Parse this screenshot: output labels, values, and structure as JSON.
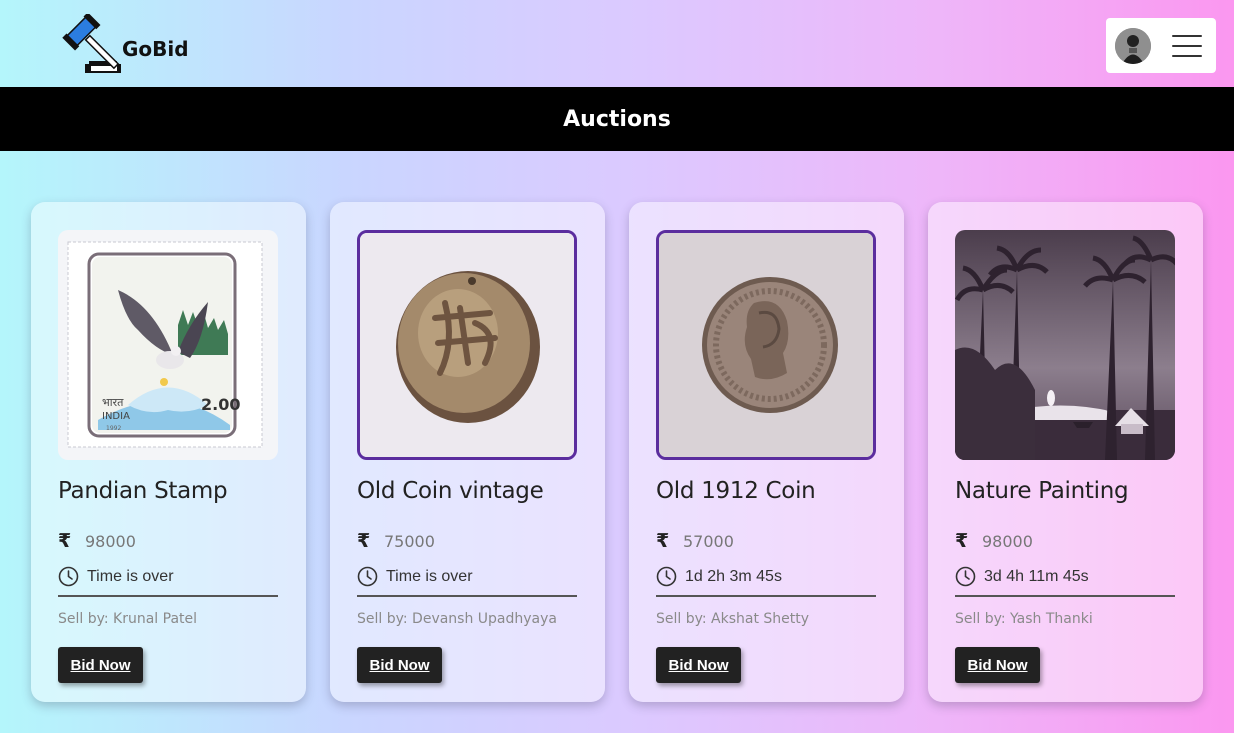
{
  "app": {
    "name": "GoBid"
  },
  "header": {
    "menu_icon": "hamburger-icon",
    "avatar_icon": "user-avatar"
  },
  "banner": {
    "title": "Auctions"
  },
  "currency_symbol": "₹",
  "cards": [
    {
      "title": "Pandian Stamp",
      "price": "98000",
      "time": "Time is over",
      "seller": "Sell by: Krunal Patel",
      "button": "Bid Now",
      "image": "stamp-image"
    },
    {
      "title": "Old Coin vintage",
      "price": "75000",
      "time": "Time is over",
      "seller": "Sell by: Devansh Upadhyaya",
      "button": "Bid Now",
      "image": "coin-image"
    },
    {
      "title": "Old 1912 Coin",
      "price": "57000",
      "time": "1d 2h 3m 45s",
      "seller": "Sell by: Akshat Shetty",
      "button": "Bid Now",
      "image": "coin-image"
    },
    {
      "title": "Nature Painting",
      "price": "98000",
      "time": "3d 4h 11m 45s",
      "seller": "Sell by: Yash Thanki",
      "button": "Bid Now",
      "image": "painting-image"
    }
  ],
  "stamp": {
    "country": "भारत",
    "country_en": "INDIA",
    "value": "2.00",
    "year": "1992"
  },
  "colors": {
    "accent": "#5b2d9e",
    "button": "#222222",
    "banner": "#000000"
  }
}
